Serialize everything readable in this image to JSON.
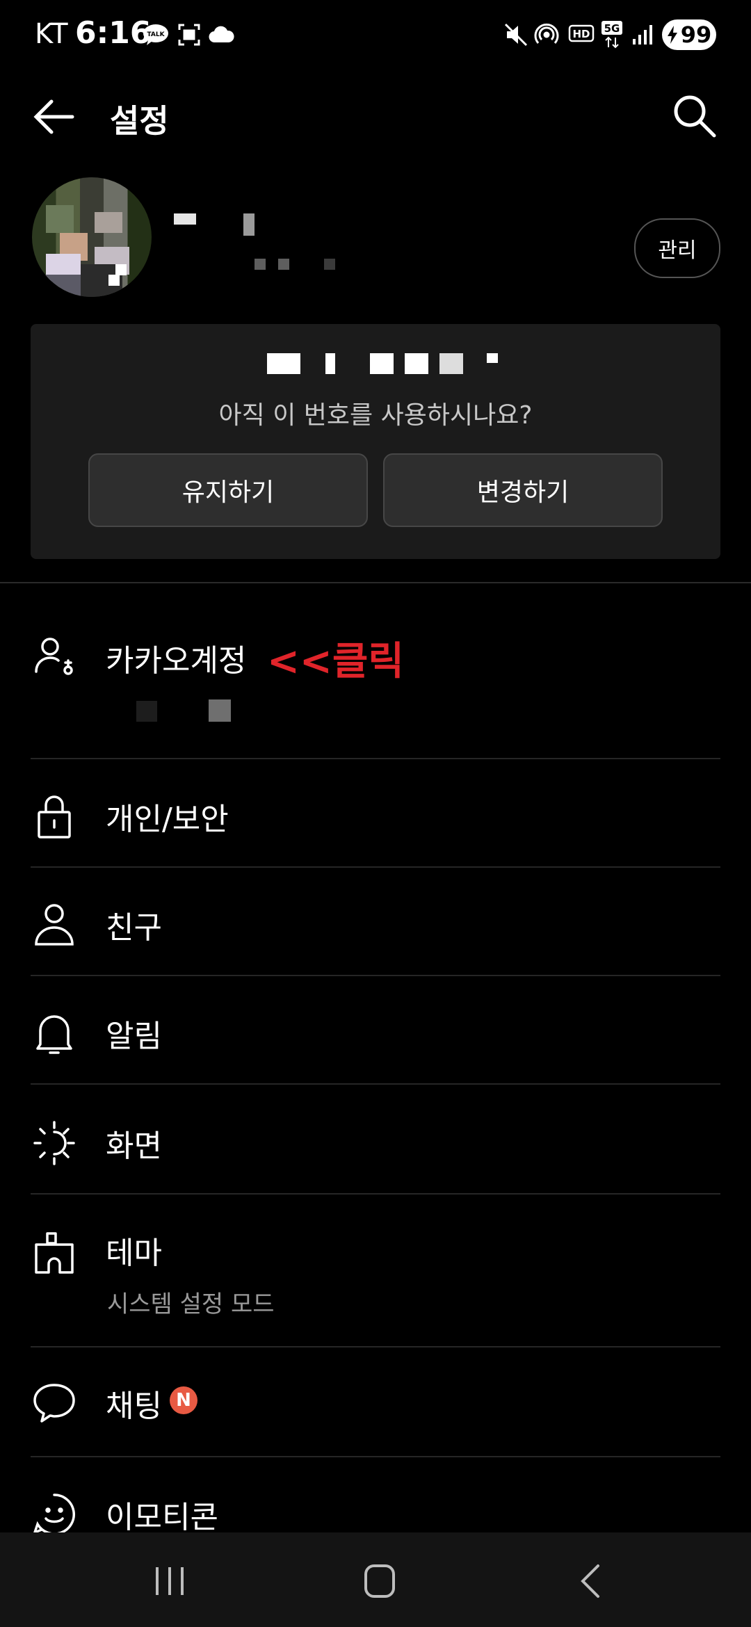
{
  "status_bar": {
    "carrier": "KT",
    "time": "6:16",
    "battery": "99",
    "icons": [
      "talk-icon",
      "screenshot-icon",
      "cloud-icon",
      "mute-icon",
      "hotspot-icon",
      "hd-icon",
      "5g-icon",
      "signal-icon",
      "battery-icon"
    ]
  },
  "app_bar": {
    "title": "설정"
  },
  "profile": {
    "manage_label": "관리"
  },
  "number_card": {
    "question": "아직 이 번호를 사용하시나요?",
    "keep_label": "유지하기",
    "change_label": "변경하기"
  },
  "menu": {
    "items": [
      {
        "label": "카카오계정",
        "icon": "account-icon",
        "annotation": "<<클릭"
      },
      {
        "label": "개인/보안",
        "icon": "lock-icon"
      },
      {
        "label": "친구",
        "icon": "person-icon"
      },
      {
        "label": "알림",
        "icon": "bell-icon"
      },
      {
        "label": "화면",
        "icon": "brightness-icon"
      },
      {
        "label": "테마",
        "icon": "theme-icon",
        "sub": "시스템 설정 모드"
      },
      {
        "label": "채팅",
        "icon": "chat-icon",
        "badge": "N"
      },
      {
        "label": "이모티콘",
        "icon": "emoticon-icon"
      }
    ]
  },
  "colors": {
    "background": "#000000",
    "card": "#1b1b1b",
    "annotation": "#e0242a",
    "badge": "#e85a43"
  }
}
